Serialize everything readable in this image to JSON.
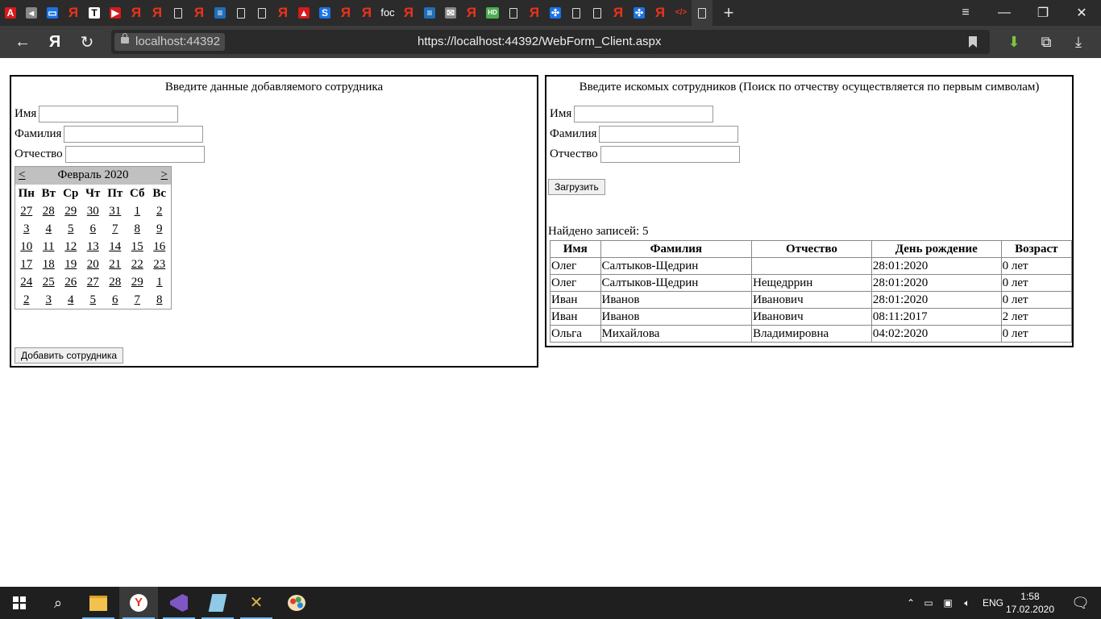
{
  "browser": {
    "tabs": [
      {
        "icon": "adobe-icon",
        "glyph": "A"
      },
      {
        "icon": "speaker-icon",
        "glyph": "◂"
      },
      {
        "icon": "chat-icon",
        "glyph": "▭"
      },
      {
        "icon": "yandex-icon",
        "glyph": "Я"
      },
      {
        "icon": "t-icon",
        "glyph": "T"
      },
      {
        "icon": "youtube-icon",
        "glyph": "▶"
      },
      {
        "icon": "yandex-icon",
        "glyph": "Я"
      },
      {
        "icon": "yandex-icon",
        "glyph": "Я"
      },
      {
        "icon": "document-icon",
        "glyph": ""
      },
      {
        "icon": "yandex-icon",
        "glyph": "Я"
      },
      {
        "icon": "database-icon",
        "glyph": "≡"
      },
      {
        "icon": "document-icon",
        "glyph": ""
      },
      {
        "icon": "document-icon",
        "glyph": ""
      },
      {
        "icon": "yandex-icon",
        "glyph": "Я"
      },
      {
        "icon": "triangle-icon",
        "glyph": "▲"
      },
      {
        "icon": "sqlru-icon",
        "glyph": "S"
      },
      {
        "icon": "yandex-icon",
        "glyph": "Я"
      },
      {
        "icon": "yandex-icon",
        "glyph": "Я"
      },
      {
        "icon": "text-tab",
        "glyph": "foc"
      },
      {
        "icon": "yandex-icon",
        "glyph": "Я"
      },
      {
        "icon": "stackoverflow-icon",
        "glyph": "≡"
      },
      {
        "icon": "mail-icon",
        "glyph": "✉"
      },
      {
        "icon": "yandex-icon",
        "glyph": "Я"
      },
      {
        "icon": "hd-icon",
        "glyph": "HD"
      },
      {
        "icon": "document-icon",
        "glyph": ""
      },
      {
        "icon": "yandex-icon",
        "glyph": "Я"
      },
      {
        "icon": "network-icon",
        "glyph": "✣"
      },
      {
        "icon": "document-icon",
        "glyph": ""
      },
      {
        "icon": "document-icon",
        "glyph": ""
      },
      {
        "icon": "yandex-icon",
        "glyph": "Я"
      },
      {
        "icon": "network-icon",
        "glyph": "✣"
      },
      {
        "icon": "yandex-icon",
        "glyph": "Я"
      },
      {
        "icon": "code-icon",
        "glyph": "</>"
      },
      {
        "icon": "document-icon",
        "glyph": ""
      }
    ],
    "host": "localhost:44392",
    "url": "https://localhost:44392/WebForm_Client.aspx"
  },
  "add_panel": {
    "title": "Введите данные добавляемого сотрудника",
    "first_name_label": "Имя",
    "last_name_label": "Фамилия",
    "patronymic_label": "Отчество",
    "add_button": "Добавить сотрудника",
    "calendar": {
      "prev": "<",
      "next": ">",
      "month": "Февраль 2020",
      "weekdays": [
        "Пн",
        "Вт",
        "Ср",
        "Чт",
        "Пт",
        "Сб",
        "Вс"
      ],
      "days": [
        "27",
        "28",
        "29",
        "30",
        "31",
        "1",
        "2",
        "3",
        "4",
        "5",
        "6",
        "7",
        "8",
        "9",
        "10",
        "11",
        "12",
        "13",
        "14",
        "15",
        "16",
        "17",
        "18",
        "19",
        "20",
        "21",
        "22",
        "23",
        "24",
        "25",
        "26",
        "27",
        "28",
        "29",
        "1",
        "2",
        "3",
        "4",
        "5",
        "6",
        "7",
        "8"
      ]
    }
  },
  "search_panel": {
    "title": "Введите искомых сотрудников (Поиск по отчеству осуществляется по первым символам)",
    "first_name_label": "Имя",
    "last_name_label": "Фамилия",
    "patronymic_label": "Отчество",
    "load_button": "Загрузить",
    "found_text": "Найдено записей: 5",
    "columns": [
      "Имя",
      "Фамилия",
      "Отчество",
      "День рождение",
      "Возраст"
    ],
    "rows": [
      [
        "Олег",
        "Салтыков-Щедрин",
        "",
        "28:01:2020",
        "0 лет"
      ],
      [
        "Олег",
        "Салтыков-Щедрин",
        "Нещедррин",
        "28:01:2020",
        "0 лет"
      ],
      [
        "Иван",
        "Иванов",
        "Иванович",
        "28:01:2020",
        "0 лет"
      ],
      [
        "Иван",
        "Иванов",
        "Иванович",
        "08:11:2017",
        "2 лет"
      ],
      [
        "Ольга",
        "Михайлова",
        "Владимировна",
        "04:02:2020",
        "0 лет"
      ]
    ]
  },
  "taskbar": {
    "language": "ENG",
    "time": "1:58",
    "date": "17.02.2020"
  }
}
